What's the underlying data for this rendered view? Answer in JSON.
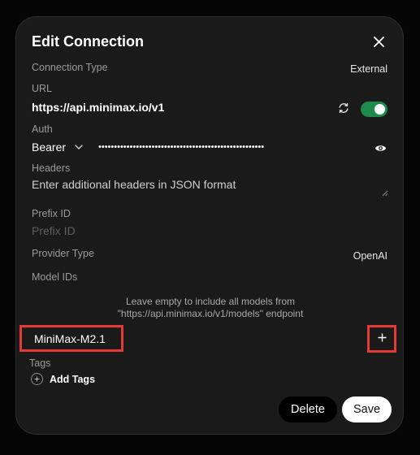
{
  "dialog": {
    "title": "Edit Connection"
  },
  "connection_type": {
    "label": "Connection Type",
    "value": "External"
  },
  "url": {
    "label": "URL",
    "value": "https://api.minimax.io/v1",
    "enabled": true
  },
  "auth": {
    "label": "Auth",
    "method": "Bearer",
    "masked_key": "•••••••••••••••••••••••••••••••••••••••••••••••••••••"
  },
  "headers": {
    "label": "Headers",
    "placeholder": "Enter additional headers in JSON format"
  },
  "prefix_id": {
    "label": "Prefix ID",
    "placeholder": "Prefix ID"
  },
  "provider_type": {
    "label": "Provider Type",
    "value": "OpenAI"
  },
  "model_ids": {
    "label": "Model IDs",
    "hint_line1": "Leave empty to include all models from",
    "hint_line2": "\"https://api.minimax.io/v1/models\" endpoint",
    "input_value": "MiniMax-M2.1"
  },
  "tags": {
    "label": "Tags",
    "add_label": "Add Tags"
  },
  "actions": {
    "delete_label": "Delete",
    "save_label": "Save"
  },
  "colors": {
    "toggle_on": "#1e8a4c",
    "highlight": "#e53935",
    "surface": "#1a1a1a"
  }
}
